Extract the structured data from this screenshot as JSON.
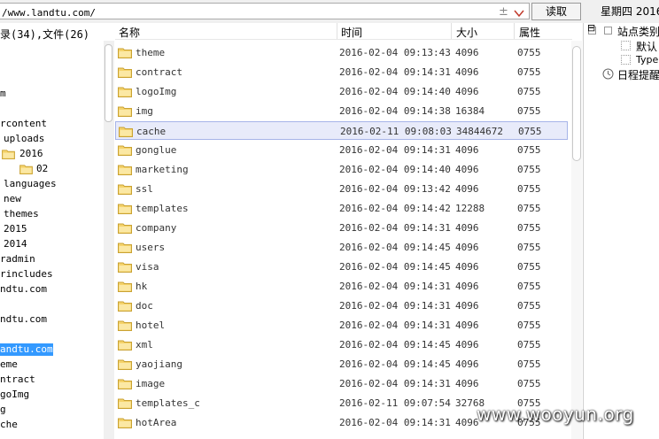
{
  "toolbar": {
    "url_value": "/www.landtu.com/",
    "plus_symbol": "±",
    "read_label": "读取",
    "date_text": "星期四 2016"
  },
  "tree": {
    "summary": "录(34),文件(26)",
    "items": [
      {
        "label": "m",
        "indent": 0,
        "folder": false
      },
      {
        "label": "rcontent",
        "indent": 0,
        "folder": false
      },
      {
        "label": "uploads",
        "indent": 1,
        "folder": false
      },
      {
        "label": "2016",
        "indent": 2,
        "folder": true
      },
      {
        "label": "02",
        "indent": 3,
        "folder": true
      },
      {
        "label": "languages",
        "indent": 1,
        "folder": false
      },
      {
        "label": "new",
        "indent": 1,
        "folder": false
      },
      {
        "label": "themes",
        "indent": 1,
        "folder": false
      },
      {
        "label": "2015",
        "indent": 1,
        "folder": false
      },
      {
        "label": "2014",
        "indent": 1,
        "folder": false
      },
      {
        "label": "radmin",
        "indent": 0,
        "folder": false
      },
      {
        "label": "rincludes",
        "indent": 0,
        "folder": false
      },
      {
        "label": "ndtu.com",
        "indent": 0,
        "folder": false
      },
      {
        "label": "ndtu.com",
        "indent": 0,
        "folder": false
      },
      {
        "label": "andtu.com",
        "indent": 0,
        "folder": false,
        "selected": true
      },
      {
        "label": "eme",
        "indent": 0,
        "folder": false
      },
      {
        "label": "ntract",
        "indent": 0,
        "folder": false
      },
      {
        "label": "goImg",
        "indent": 0,
        "folder": false
      },
      {
        "label": "g",
        "indent": 0,
        "folder": false
      },
      {
        "label": "che",
        "indent": 0,
        "folder": false
      }
    ]
  },
  "list": {
    "headers": {
      "name": "名称",
      "time": "时间",
      "size": "大小",
      "attr": "属性"
    },
    "rows": [
      {
        "name": "theme",
        "time": "2016-02-04 09:13:43",
        "size": "4096",
        "attr": "0755"
      },
      {
        "name": "contract",
        "time": "2016-02-04 09:14:31",
        "size": "4096",
        "attr": "0755"
      },
      {
        "name": "logoImg",
        "time": "2016-02-04 09:14:40",
        "size": "4096",
        "attr": "0755"
      },
      {
        "name": "img",
        "time": "2016-02-04 09:14:38",
        "size": "16384",
        "attr": "0755"
      },
      {
        "name": "cache",
        "time": "2016-02-11 09:08:03",
        "size": "34844672",
        "attr": "0755",
        "selected": true
      },
      {
        "name": "gonglue",
        "time": "2016-02-04 09:14:31",
        "size": "4096",
        "attr": "0755"
      },
      {
        "name": "marketing",
        "time": "2016-02-04 09:14:40",
        "size": "4096",
        "attr": "0755"
      },
      {
        "name": "ssl",
        "time": "2016-02-04 09:13:42",
        "size": "4096",
        "attr": "0755"
      },
      {
        "name": "templates",
        "time": "2016-02-04 09:14:42",
        "size": "12288",
        "attr": "0755"
      },
      {
        "name": "company",
        "time": "2016-02-04 09:14:31",
        "size": "4096",
        "attr": "0755"
      },
      {
        "name": "users",
        "time": "2016-02-04 09:14:45",
        "size": "4096",
        "attr": "0755"
      },
      {
        "name": "visa",
        "time": "2016-02-04 09:14:45",
        "size": "4096",
        "attr": "0755"
      },
      {
        "name": "hk",
        "time": "2016-02-04 09:14:31",
        "size": "4096",
        "attr": "0755"
      },
      {
        "name": "doc",
        "time": "2016-02-04 09:14:31",
        "size": "4096",
        "attr": "0755"
      },
      {
        "name": "hotel",
        "time": "2016-02-04 09:14:31",
        "size": "4096",
        "attr": "0755"
      },
      {
        "name": "xml",
        "time": "2016-02-04 09:14:45",
        "size": "4096",
        "attr": "0755"
      },
      {
        "name": "yaojiang",
        "time": "2016-02-04 09:14:45",
        "size": "4096",
        "attr": "0755"
      },
      {
        "name": "image",
        "time": "2016-02-04 09:14:31",
        "size": "4096",
        "attr": "0755"
      },
      {
        "name": "templates_c",
        "time": "2016-02-11 09:07:54",
        "size": "32768",
        "attr": "0755"
      },
      {
        "name": "hotArea",
        "time": "2016-02-04 09:14:31",
        "size": "4096",
        "attr": "0755"
      }
    ]
  },
  "right": {
    "site_category": "站点类别",
    "default_label": "默认",
    "type_label": "Type",
    "schedule_label": "日程提醒",
    "collapse_symbol": "⊟"
  },
  "watermark": "www.wooyun.org",
  "colors": {
    "selection": "#3399ff",
    "row_highlight": "#e8ebfa",
    "folder": "#f5d36b"
  }
}
